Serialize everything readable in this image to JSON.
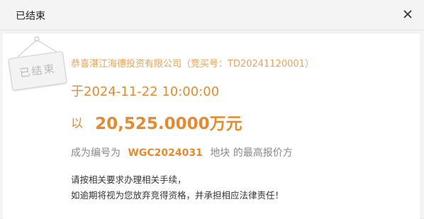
{
  "dialog": {
    "title": "已结束",
    "close_icon": "close-icon"
  },
  "stamp": {
    "text": "已结束",
    "icon": "hanging-sign-stamp"
  },
  "result": {
    "winner_line": "恭喜湛江海德投资有限公司（竞买号：TD20241120001）",
    "date_line": "于2024-11-22 10:00:00",
    "price_prefix": "以",
    "price_amount": "20,525.0000万元",
    "parcel_prefix": "成为编号为",
    "parcel_code": "WGC2024031",
    "parcel_suffix": "地块 的最高报价方"
  },
  "notice": {
    "line1": "请按相关要求办理相关手续，",
    "line2": "如逾期将视为您放弃竞得资格，并承担相应法律责任！"
  },
  "colors": {
    "accent": "#e38b2e",
    "accent_light": "#e8a25a",
    "muted": "#888888",
    "text": "#333333"
  }
}
